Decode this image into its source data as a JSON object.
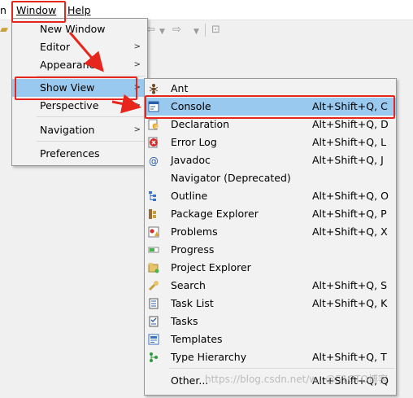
{
  "menubar": {
    "file_partial": "n",
    "window": "Window",
    "help": "Help"
  },
  "window_menu": {
    "items": [
      {
        "label": "New Window"
      },
      {
        "label": "Editor"
      },
      {
        "label": "Appearance"
      },
      {
        "label": "Show View"
      },
      {
        "label": "Perspective"
      },
      {
        "label": "Navigation"
      },
      {
        "label": "Preferences"
      }
    ]
  },
  "show_view_menu": {
    "items": [
      {
        "label": "Ant",
        "shortcut": "",
        "icon": "ant-icon"
      },
      {
        "label": "Console",
        "shortcut": "Alt+Shift+Q, C",
        "icon": "console-icon"
      },
      {
        "label": "Declaration",
        "shortcut": "Alt+Shift+Q, D",
        "icon": "declaration-icon"
      },
      {
        "label": "Error Log",
        "shortcut": "Alt+Shift+Q, L",
        "icon": "error-log-icon"
      },
      {
        "label": "Javadoc",
        "shortcut": "Alt+Shift+Q, J",
        "icon": "javadoc-icon"
      },
      {
        "label": "Navigator (Deprecated)",
        "shortcut": "",
        "icon": "navigator-icon"
      },
      {
        "label": "Outline",
        "shortcut": "Alt+Shift+Q, O",
        "icon": "outline-icon"
      },
      {
        "label": "Package Explorer",
        "shortcut": "Alt+Shift+Q, P",
        "icon": "package-explorer-icon"
      },
      {
        "label": "Problems",
        "shortcut": "Alt+Shift+Q, X",
        "icon": "problems-icon"
      },
      {
        "label": "Progress",
        "shortcut": "",
        "icon": "progress-icon"
      },
      {
        "label": "Project Explorer",
        "shortcut": "",
        "icon": "project-explorer-icon"
      },
      {
        "label": "Search",
        "shortcut": "Alt+Shift+Q, S",
        "icon": "search-icon"
      },
      {
        "label": "Task List",
        "shortcut": "Alt+Shift+Q, K",
        "icon": "task-list-icon"
      },
      {
        "label": "Tasks",
        "shortcut": "",
        "icon": "tasks-icon"
      },
      {
        "label": "Templates",
        "shortcut": "",
        "icon": "templates-icon"
      },
      {
        "label": "Type Hierarchy",
        "shortcut": "Alt+Shift+Q, T",
        "icon": "type-hierarchy-icon"
      },
      {
        "label": "Other...",
        "shortcut": "Alt+Shift+Q, Q",
        "icon": ""
      }
    ]
  },
  "watermark": "https://blog.csdn.net/w...@51CTO博客",
  "colors": {
    "highlight": "#99c9ef",
    "annotation_red": "#e8251c"
  }
}
